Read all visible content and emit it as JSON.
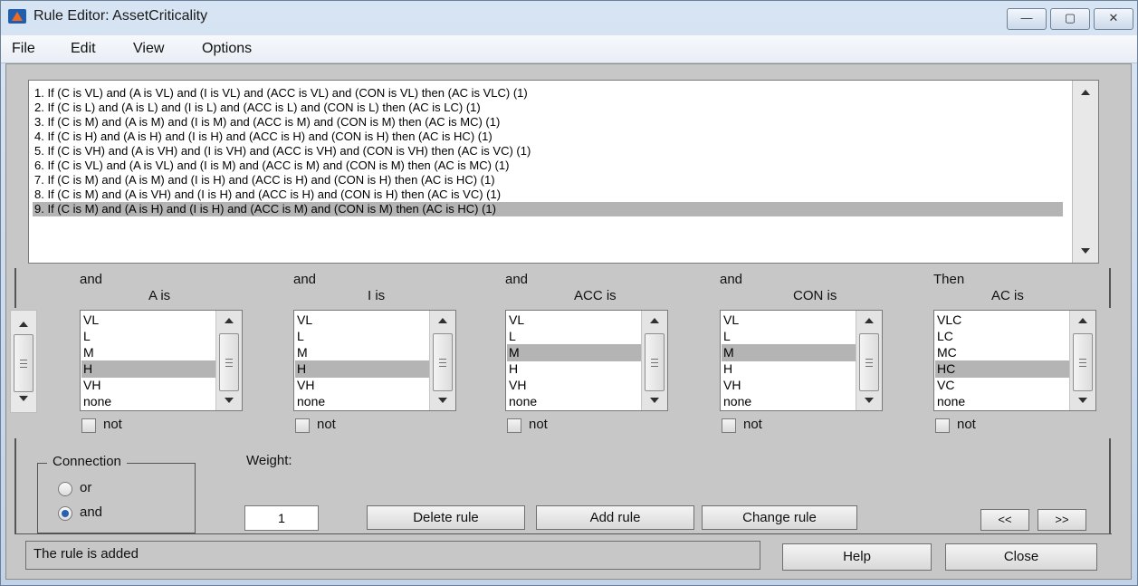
{
  "window": {
    "title": "Rule Editor: AssetCriticality",
    "controls": [
      "—",
      "▢",
      "✕"
    ]
  },
  "menu": [
    "File",
    "Edit",
    "View",
    "Options"
  ],
  "rules": [
    "1. If (C is VL) and (A is VL) and (I is VL) and (ACC is VL) and (CON is VL) then (AC is VLC) (1)",
    "2. If (C is L) and (A is L) and (I is L) and (ACC is L) and (CON is L) then (AC is LC) (1)",
    "3. If (C is M) and (A is M) and (I is M) and (ACC is M) and (CON is M) then (AC is MC) (1)",
    "4. If (C is H) and (A is H) and (I is H) and (ACC is H) and (CON is H) then (AC is HC) (1)",
    "5. If (C is VH) and (A is VH) and (I is VH) and (ACC is VH) and (CON is VH) then (AC is VC) (1)",
    "6. If (C is VL) and (A is VL) and (I is M) and (ACC is M) and (CON is M) then (AC is MC) (1)",
    "7. If (C is M) and (A is M) and (I is H) and (ACC is H) and (CON is H) then (AC is HC) (1)",
    "8. If (C is M) and (A is VH) and (I is H) and (ACC is H) and (CON is H) then (AC is VC) (1)",
    "9. If (C is M) and (A is H) and (I is H) and (ACC is M) and (CON is M) then (AC is HC) (1)"
  ],
  "selected_rule_index": 8,
  "variables": [
    {
      "connector": "and",
      "label": "A is",
      "options": [
        "VL",
        "L",
        "M",
        "H",
        "VH",
        "none"
      ],
      "selected": "H",
      "not_label": "not"
    },
    {
      "connector": "and",
      "label": "I is",
      "options": [
        "VL",
        "L",
        "M",
        "H",
        "VH",
        "none"
      ],
      "selected": "H",
      "not_label": "not"
    },
    {
      "connector": "and",
      "label": "ACC is",
      "options": [
        "VL",
        "L",
        "M",
        "H",
        "VH",
        "none"
      ],
      "selected": "M",
      "not_label": "not"
    },
    {
      "connector": "and",
      "label": "CON is",
      "options": [
        "VL",
        "L",
        "M",
        "H",
        "VH",
        "none"
      ],
      "selected": "M",
      "not_label": "not"
    },
    {
      "connector": "Then",
      "label": "AC is",
      "options": [
        "VLC",
        "LC",
        "MC",
        "HC",
        "VC",
        "none"
      ],
      "selected": "HC",
      "not_label": "not"
    }
  ],
  "connection": {
    "title": "Connection",
    "options": [
      "or",
      "and"
    ],
    "selected": "and"
  },
  "weight": {
    "label": "Weight:",
    "value": "1"
  },
  "buttons": {
    "delete": "Delete rule",
    "add": "Add rule",
    "change": "Change rule",
    "prev": "<<",
    "next": ">>",
    "help": "Help",
    "close": "Close"
  },
  "status": "The rule is added"
}
